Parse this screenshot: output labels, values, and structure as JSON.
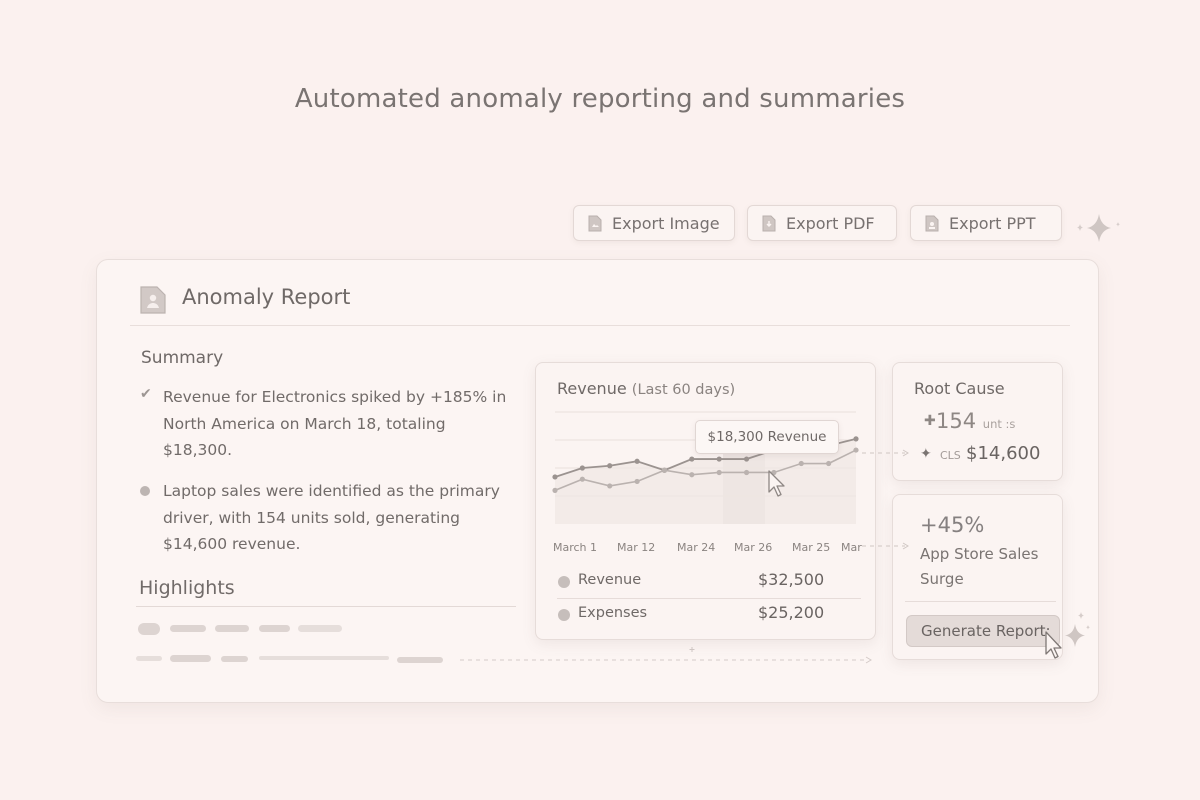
{
  "headline": "Automated anomaly reporting and summaries",
  "toolbar": {
    "buttons": [
      {
        "label": "Export Image"
      },
      {
        "label": "Export PDF"
      },
      {
        "label": "Export PPT"
      }
    ]
  },
  "report": {
    "title": "Anomaly Report",
    "summary": {
      "title": "Summary",
      "items": [
        "Revenue for Electronics spiked by +185% in North America on March 18, totaling $18,300.",
        "Laptop sales were identified as the primary driver, with 154 units sold, generating $14,600 revenue."
      ]
    },
    "highlights": {
      "title": "Highlights"
    }
  },
  "revenue_chart": {
    "title": "Revenue",
    "subtitle": "(Last 60 days)",
    "tooltip": "$18,300 Revenue",
    "legend": [
      {
        "name": "Revenue",
        "value": "$32,500"
      },
      {
        "name": "Expenses",
        "value": "$25,200"
      }
    ]
  },
  "chart_data": {
    "type": "line",
    "categories": [
      "March 1",
      "Mar 12",
      "Mar 24",
      "Mar 26",
      "Mar 25",
      "Mar"
    ],
    "series": [
      {
        "name": "Revenue",
        "values": [
          21,
          25,
          26,
          28,
          24,
          29,
          29,
          29,
          33,
          34,
          35,
          38
        ]
      },
      {
        "name": "Expenses",
        "values": [
          15,
          20,
          17,
          19,
          24,
          22,
          23,
          23,
          23,
          27,
          27,
          33
        ]
      }
    ],
    "title": "Revenue",
    "subtitle": "(Last 60 days)",
    "annotation": "$18,300 Revenue",
    "legend": [
      {
        "name": "Revenue",
        "value": "$32,500"
      },
      {
        "name": "Expenses",
        "value": "$25,200"
      }
    ],
    "grid": true
  },
  "root_cause": {
    "title": "Root Cause",
    "units_value": "154",
    "units_label": "unt :s",
    "revenue_prefix": "CLS",
    "revenue_value": "$14,600"
  },
  "app_store": {
    "percent": "+45%",
    "label": "App Store Sales Surge",
    "button_label": "Generate Report:"
  },
  "colors": {
    "background": "#fbf1ef",
    "card": "#fbf4f2",
    "line_dark": "#9b9390",
    "line_light": "#bab2af"
  }
}
